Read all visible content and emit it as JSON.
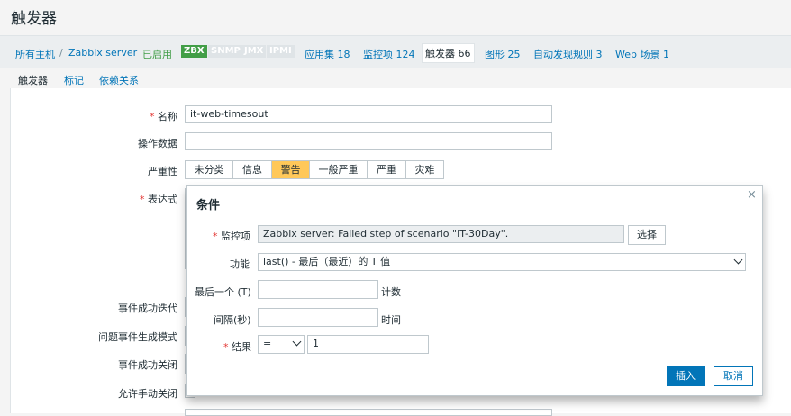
{
  "page": {
    "title": "触发器"
  },
  "breadcrumbs": {
    "all_hosts": "所有主机",
    "separator": "/",
    "host": "Zabbix server",
    "status": "已启用",
    "tags": [
      "ZBX",
      "SNMP",
      "JMX",
      "IPMI"
    ],
    "applications": "应用集 18",
    "items": "监控项 124",
    "triggers": "触发器 66",
    "graphs": "图形 25",
    "discovery": "自动发现规则 3",
    "web": "Web 场景 1"
  },
  "form_tabs": [
    "触发器",
    "标记",
    "依赖关系"
  ],
  "form": {
    "name_label": "名称",
    "name_value": "it-web-timesout",
    "opdata_label": "操作数据",
    "opdata_value": "",
    "severity_label": "严重性",
    "severity_options": [
      "未分类",
      "信息",
      "警告",
      "一般严重",
      "严重",
      "灾难"
    ],
    "severity_selected": "警告",
    "expression_label": "表达式",
    "ok_event_label": "事件成功迭代",
    "problem_mode_label": "问题事件生成模式",
    "ok_close_label": "事件成功关闭",
    "manual_close_label": "允许手动关闭"
  },
  "dialog": {
    "title": "条件",
    "close_icon": "×",
    "item_label": "监控项",
    "item_value": "Zabbix server: Failed step of scenario \"IT-30Day\".",
    "select_button": "选择",
    "function_label": "功能",
    "function_value": "last() - 最后（最近）的 T 值",
    "last_label": "最后一个 (T)",
    "last_value": "",
    "last_unit": "计数",
    "interval_label": "间隔(秒)",
    "interval_value": "",
    "interval_unit": "时间",
    "result_label": "结果",
    "result_operator": "=",
    "result_value": "1",
    "insert_button": "插入",
    "cancel_button": "取消"
  },
  "colors": {
    "accent": "#0275b8",
    "enabled": "#429e47",
    "severity_warning": "#ffc859",
    "required": "#e33734"
  }
}
